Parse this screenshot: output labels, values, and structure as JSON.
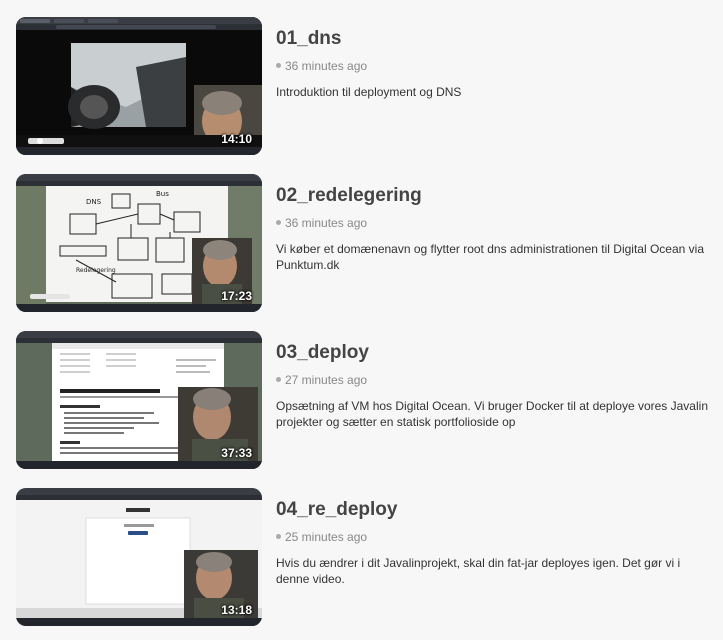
{
  "videos": [
    {
      "title": "01_dns",
      "time_ago": "36 minutes ago",
      "description": "Introduktion til deployment og DNS",
      "duration": "14:10",
      "thumbnail_icon": "video-thumbnail-driving-dashcam"
    },
    {
      "title": "02_redelegering",
      "time_ago": "36 minutes ago",
      "description": "Vi køber et domænenavn og flytter root dns administrationen til Digital Ocean via Punktum.dk",
      "duration": "17:23",
      "thumbnail_icon": "video-thumbnail-whiteboard-diagram"
    },
    {
      "title": "03_deploy",
      "time_ago": "27 minutes ago",
      "description": "Opsætning af VM hos Digital Ocean. Vi bruger Docker til at deploye vores Javalin projekter og sætter en statisk portfolioside op",
      "duration": "37:33",
      "thumbnail_icon": "video-thumbnail-tutorial-webpage"
    },
    {
      "title": "04_re_deploy",
      "time_ago": "25 minutes ago",
      "description": "Hvis du ændrer i dit Javalinprojekt, skal din fat-jar deployes igen. Det gør vi i denne video.",
      "duration": "13:18",
      "thumbnail_icon": "video-thumbnail-portfolio-page"
    }
  ]
}
